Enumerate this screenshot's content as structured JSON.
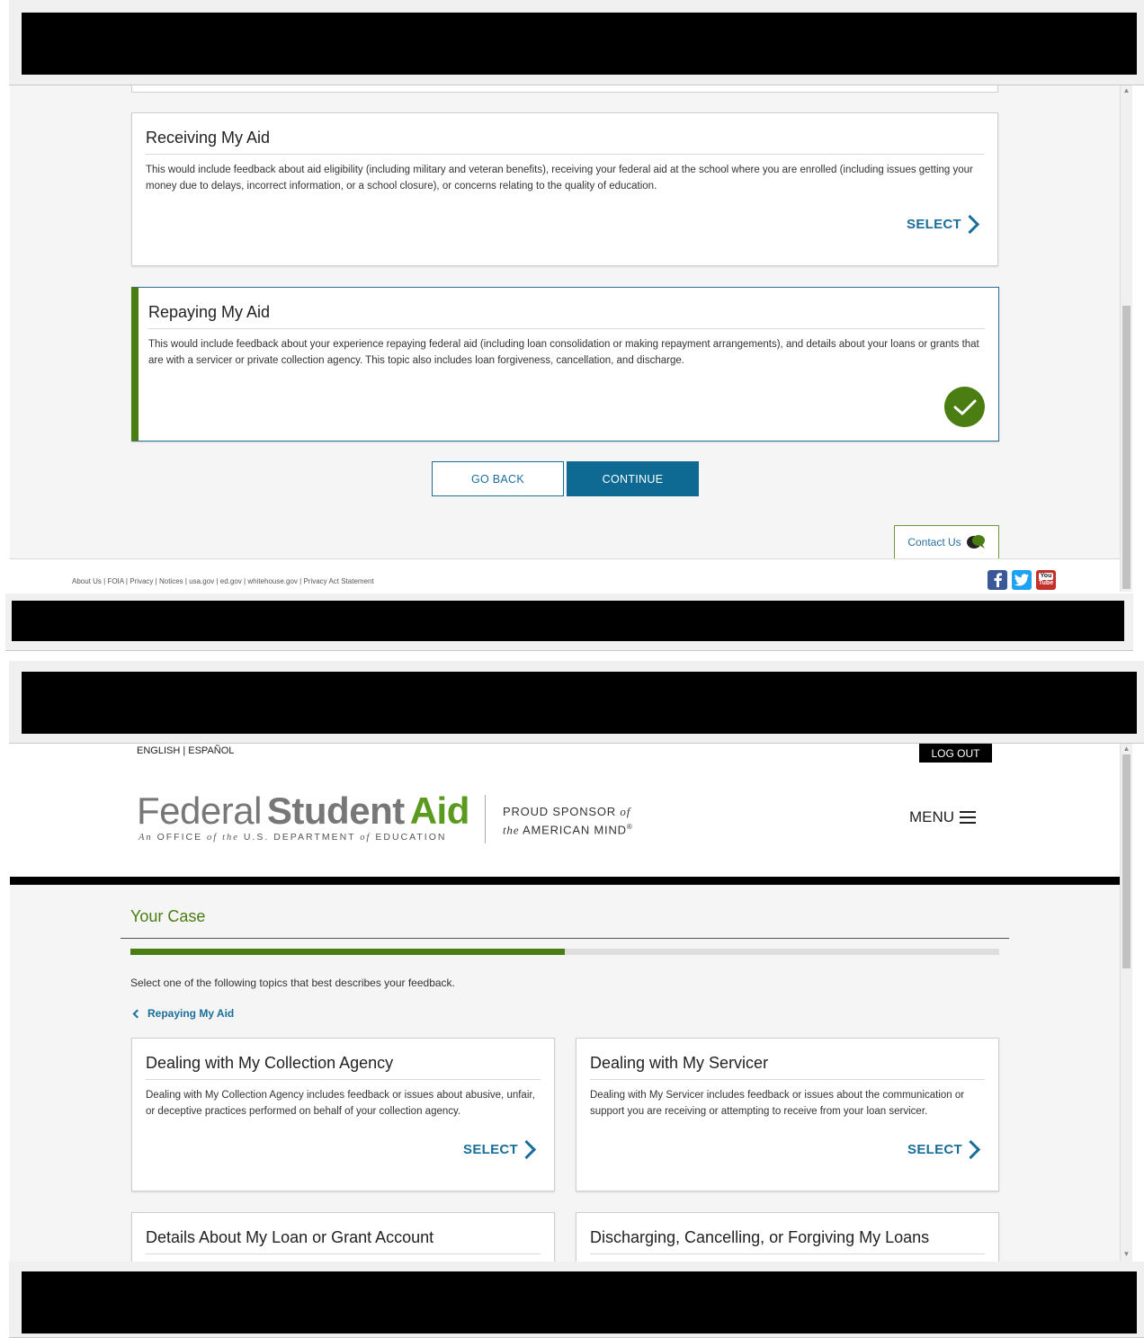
{
  "screen1": {
    "cards": [
      {
        "title": "Receiving My Aid",
        "body": "This would include feedback about aid eligibility (including military and veteran benefits), receiving your federal aid at the school where you are enrolled (including issues getting your money due to delays, incorrect information, or a school closure), or concerns relating to the quality of education.",
        "action": "SELECT",
        "selected": false
      },
      {
        "title": "Repaying My Aid",
        "body": "This would include feedback about your experience repaying federal aid (including loan consolidation or making repayment arrangements), and details about your loans or grants that are with a servicer or private collection agency. This topic also includes loan forgiveness, cancellation, and discharge.",
        "selected": true
      }
    ],
    "go_back": "GO BACK",
    "continue": "CONTINUE",
    "contact_us": "Contact Us",
    "footer_links": [
      "About Us",
      "FOIA",
      "Privacy",
      "Notices",
      "usa.gov",
      "ed.gov",
      "whitehouse.gov",
      "Privacy Act Statement"
    ],
    "social": [
      "facebook-icon",
      "twitter-icon",
      "youtube-icon"
    ]
  },
  "screen2": {
    "language": "ENGLISH | ESPAÑOL",
    "logout": "LOG OUT",
    "brand": {
      "federal": "Federal",
      "student": "Student",
      "aid": "Aid",
      "sub_an": "An",
      "sub_office": "OFFICE",
      "sub_of1": "of",
      "sub_the": "the",
      "sub_dept": "U.S. DEPARTMENT",
      "sub_of2": "of",
      "sub_edu": "EDUCATION",
      "sponsor_line1": "PROUD SPONSOR",
      "sponsor_of": "of",
      "sponsor_the": "the",
      "sponsor_line2": "AMERICAN MIND",
      "sponsor_reg": "®"
    },
    "menu": "MENU",
    "case_title": "Your Case",
    "progress": 0.5,
    "instruction": "Select one of the following topics that best describes your feedback.",
    "breadcrumb": "Repaying My Aid",
    "cards": [
      {
        "title": "Dealing with My Collection Agency",
        "body": "Dealing with My Collection Agency includes feedback or issues about abusive, unfair, or deceptive practices performed on behalf of your collection agency.",
        "action": "SELECT"
      },
      {
        "title": "Dealing with My Servicer",
        "body": "Dealing with My Servicer includes feedback or issues about the communication or support you are receiving or attempting to receive from your loan servicer.",
        "action": "SELECT"
      },
      {
        "title": "Details About My Loan or Grant Account"
      },
      {
        "title": "Discharging, Cancelling, or Forgiving My Loans"
      }
    ]
  },
  "colors": {
    "accent_green": "#4a7d12",
    "link_blue": "#1a6e9a",
    "continue_blue": "#0f6a93"
  }
}
